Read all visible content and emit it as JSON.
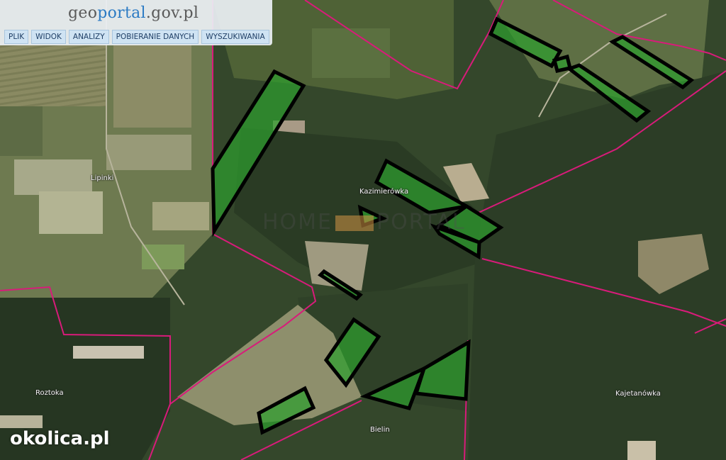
{
  "header": {
    "logo_prefix": "geo",
    "logo_accent": "portal",
    "logo_suffix": ".gov.pl",
    "menu": [
      {
        "label": "PLIK"
      },
      {
        "label": "WIDOK"
      },
      {
        "label": "ANALIZY"
      },
      {
        "label": "POBIERANIE DANYCH"
      },
      {
        "label": "WYSZUKIWANIA"
      }
    ]
  },
  "places": {
    "lipinki": "Lipinki",
    "kazimierowka": "Kazimierówka",
    "roztoka": "Roztoka",
    "kajetanowka": "Kajetanówka",
    "bielin": "Bielin"
  },
  "watermark": {
    "left": "HOME",
    "right": "PORTAL"
  },
  "brand": "okolica.pl",
  "colors": {
    "boundary": "#d81b7a",
    "parcel_fill": "#2e9e2e",
    "parcel_stroke": "#000000",
    "accent": "#2c7bc4"
  }
}
